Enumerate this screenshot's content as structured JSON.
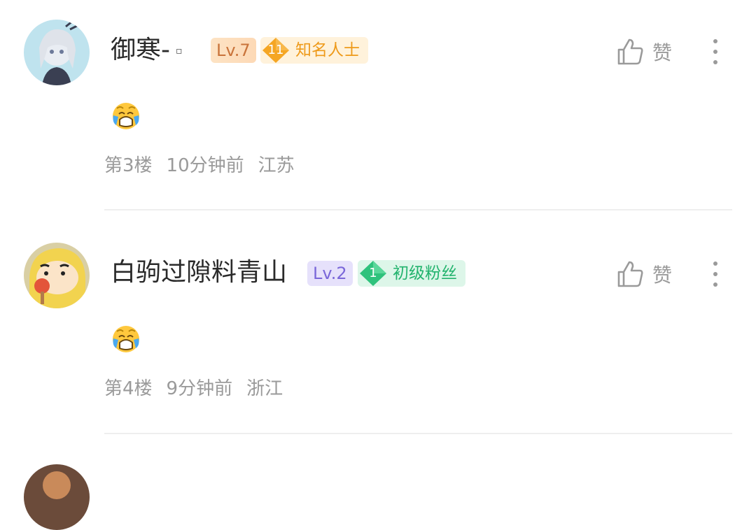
{
  "comments": [
    {
      "username": "御寒-",
      "name_tag": "▫",
      "level": "Lv.7",
      "fan_badge": {
        "number": "11",
        "label": "知名人士",
        "color": "#f5a623"
      },
      "like_label": "赞",
      "content_emoji": "crying-face",
      "floor": "第3楼",
      "time": "10分钟前",
      "location": "江苏"
    },
    {
      "username": "白驹过隙料青山",
      "level": "Lv.2",
      "fan_badge": {
        "number": "1",
        "label": "初级粉丝",
        "color": "#2fc27c"
      },
      "like_label": "赞",
      "content_emoji": "crying-face",
      "floor": "第4楼",
      "time": "9分钟前",
      "location": "浙江"
    }
  ]
}
